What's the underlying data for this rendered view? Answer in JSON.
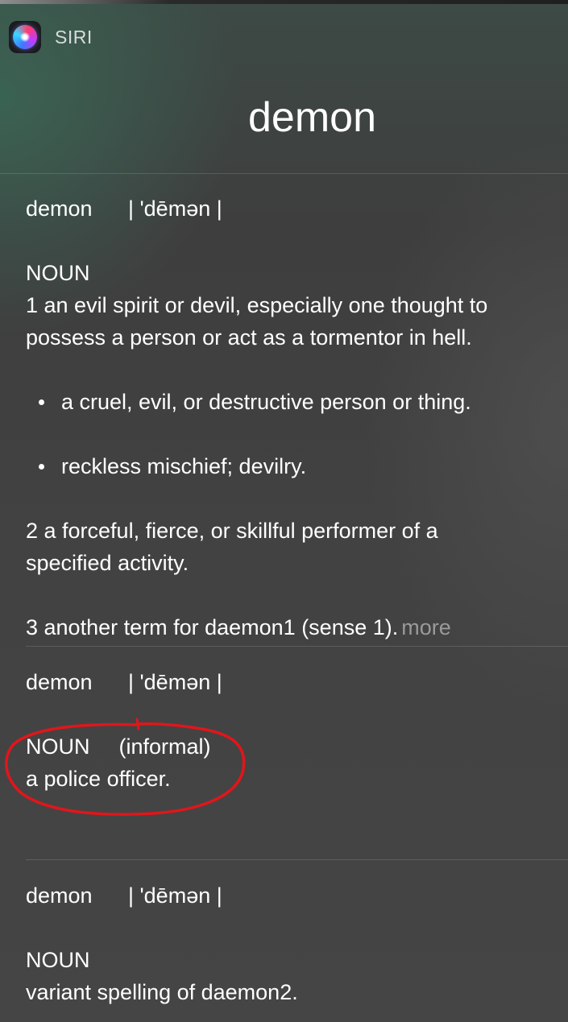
{
  "app": {
    "name": "SIRI"
  },
  "title": "demon",
  "entries": [
    {
      "headword": "demon",
      "pronunciation": "| 'dēmən |",
      "pos": "NOUN",
      "sense1_line1": "1  an evil spirit or devil, especially one thought to",
      "sense1_line2": "possess a person or act as a tormentor in hell.",
      "bullets": [
        "a cruel, evil, or destructive person or thing.",
        "reckless mischief; devilry."
      ],
      "sense2_line1": "2  a forceful, fierce, or skillful performer of a",
      "sense2_line2": "specified activity.",
      "sense3": "3  another term for daemon1 (sense 1).",
      "more": "more"
    },
    {
      "headword": "demon",
      "pronunciation": "| 'dēmən |",
      "pos": "NOUN",
      "register": "(informal)",
      "definition": "a police officer."
    },
    {
      "headword": "demon",
      "pronunciation": "| 'dēmən |",
      "pos": "NOUN",
      "definition": "variant spelling of daemon2."
    }
  ],
  "annotation": {
    "color": "#e0161b"
  }
}
